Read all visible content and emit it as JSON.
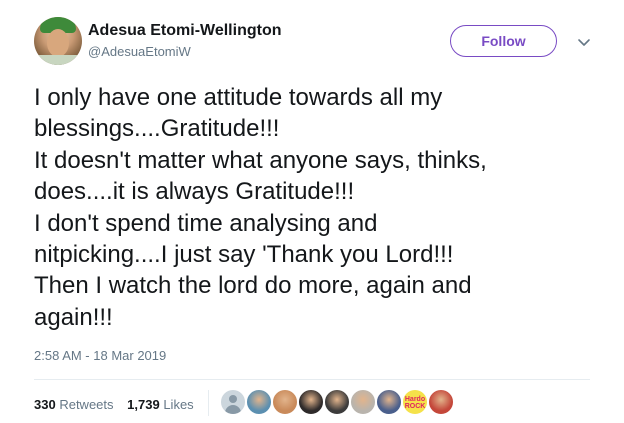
{
  "user": {
    "display_name": "Adesua Etomi-Wellington",
    "handle": "@AdesuaEtomiW"
  },
  "actions": {
    "follow_label": "Follow",
    "more_icon": "chevron-down-icon"
  },
  "tweet": {
    "lines": [
      "I only have one attitude towards all my",
      "blessings....Gratitude!!!",
      "It doesn't matter what anyone says, thinks,",
      "does....it is always Gratitude!!!",
      "I don't spend time analysing and",
      "nitpicking....I just say 'Thank you Lord!!!",
      "Then I watch the lord do more, again and",
      "again!!!"
    ],
    "timestamp": "2:58 AM - 18 Mar 2019"
  },
  "stats": {
    "retweets_count": "330",
    "retweets_label": "Retweets",
    "likes_count": "1,739",
    "likes_label": "Likes"
  },
  "likers": [
    {
      "kind": "default-avatar",
      "color": "#ccd6dd"
    },
    {
      "kind": "photo",
      "color": "#5b8fb0"
    },
    {
      "kind": "photo",
      "color": "#c98a5a"
    },
    {
      "kind": "photo",
      "color": "#2e2a2a"
    },
    {
      "kind": "photo",
      "color": "#3c3b3b"
    },
    {
      "kind": "photo",
      "color": "#b9b4ad"
    },
    {
      "kind": "photo",
      "color": "#4a5f8c"
    },
    {
      "kind": "logo",
      "color": "#f5e24a",
      "text": "Hardo ROCK"
    },
    {
      "kind": "photo",
      "color": "#c4473a"
    }
  ],
  "colors": {
    "accent": "#794bc4",
    "text": "#14171a",
    "muted": "#657786",
    "divider": "#e6ecf0"
  }
}
